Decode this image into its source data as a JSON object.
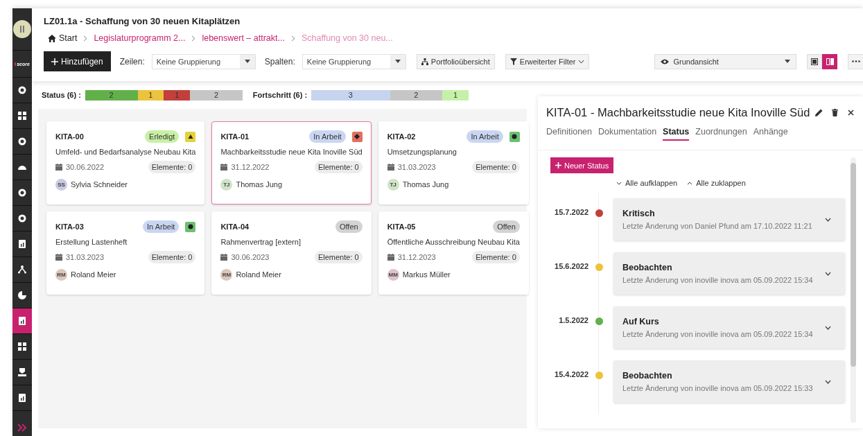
{
  "sidebar": {
    "logo": "score",
    "items": [
      {
        "selected": false
      },
      {
        "selected": false
      },
      {
        "selected": false
      },
      {
        "selected": false
      },
      {
        "selected": false
      },
      {
        "selected": false
      },
      {
        "selected": false
      },
      {
        "selected": false
      },
      {
        "selected": false
      },
      {
        "selected": true
      },
      {
        "selected": false
      },
      {
        "selected": false
      },
      {
        "selected": false
      }
    ]
  },
  "header": {
    "title": "LZ01.1a - Schaffung von 30 neuen Kitaplätzen",
    "breadcrumb": [
      {
        "label": "Start",
        "kind": "home"
      },
      {
        "label": "Legislaturprogramm 2...",
        "kind": "link"
      },
      {
        "label": "lebenswert – attrakt...",
        "kind": "link"
      },
      {
        "label": "Schaffung von 30 neu...",
        "kind": "current"
      }
    ]
  },
  "toolbar": {
    "add_button": "Hinzufügen",
    "rows_label": "Zeilen:",
    "rows_value": "Keine Gruppierung",
    "columns_label": "Spalten:",
    "columns_value": "Keine Gruppierung",
    "portfolio_button": "Portfolioübersicht",
    "filter_button": "Erweiterter Filter",
    "view_select": "Grundansicht",
    "view_toggle": [
      {
        "selected": false
      },
      {
        "selected": true
      }
    ]
  },
  "status_summary": {
    "label": "Status (6) :",
    "segments": [
      {
        "count": "2",
        "color": "#62b04a"
      },
      {
        "count": "1",
        "color": "#ecc33c"
      },
      {
        "count": "1",
        "color": "#c23f3c"
      },
      {
        "count": "2",
        "color": "#c6c6c6"
      }
    ]
  },
  "progress_summary": {
    "label": "Fortschritt (6) :",
    "segments": [
      {
        "count": "3",
        "color": "#c6d4f0"
      },
      {
        "count": "2",
        "color": "#c6c6c6"
      },
      {
        "count": "1",
        "color": "#c6f0a8"
      }
    ]
  },
  "cards": [
    {
      "id": "KITA-00",
      "title": "Umfeld- und Bedarfsanalyse Neubau Kita",
      "status": {
        "label": "Erledigt",
        "kind": "done"
      },
      "indicator": {
        "kind": "triangle",
        "color": "#e4d23a"
      },
      "date": "30.06.2022",
      "elements": "Elemente: 0",
      "avatar": {
        "initials": "SS",
        "color": "#c9c9e2"
      },
      "person": "Sylvia Schneider",
      "selected": false
    },
    {
      "id": "KITA-01",
      "title": "Machbarkeitsstudie neue Kita Inoville Süd",
      "status": {
        "label": "In Arbeit",
        "kind": "progress"
      },
      "indicator": {
        "kind": "diamond",
        "color": "#e0705e"
      },
      "date": "31.12.2022",
      "elements": "Elemente: 0",
      "avatar": {
        "initials": "TJ",
        "color": "#cfe3c6"
      },
      "person": "Thomas Jung",
      "selected": true
    },
    {
      "id": "KITA-02",
      "title": "Umsetzungsplanung",
      "status": {
        "label": "In Arbeit",
        "kind": "progress"
      },
      "indicator": {
        "kind": "dot",
        "color": "#6cc070"
      },
      "date": "31.03.2023",
      "elements": "Elemente: 0",
      "avatar": {
        "initials": "TJ",
        "color": "#cfe3c6"
      },
      "person": "Thomas Jung",
      "selected": false
    },
    {
      "id": "KITA-03",
      "title": "Erstellung Lastenheft",
      "status": {
        "label": "In Arbeit",
        "kind": "progress"
      },
      "indicator": {
        "kind": "dot",
        "color": "#6cc070"
      },
      "date": "31.03.2023",
      "elements": "Elemente: 0",
      "avatar": {
        "initials": "RM",
        "color": "#dcc7bd"
      },
      "person": "Roland Meier",
      "selected": false
    },
    {
      "id": "KITA-04",
      "title": "Rahmenvertrag [extern]",
      "status": {
        "label": "Offen",
        "kind": "open"
      },
      "date": "30.06.2023",
      "elements": "Elemente: 0",
      "avatar": {
        "initials": "RM",
        "color": "#dcc7bd"
      },
      "person": "Roland Meier",
      "selected": false
    },
    {
      "id": "KITA-05",
      "title": "Öffentliche Ausschreibung Neubau Kita",
      "status": {
        "label": "Offen",
        "kind": "open"
      },
      "date": "31.12.2023",
      "elements": "Elemente: 0",
      "avatar": {
        "initials": "MM",
        "color": "#dec2cc"
      },
      "person": "Markus Müller",
      "selected": false
    }
  ],
  "detail": {
    "title": "KITA-01 - Machbarkeitsstudie neue Kita Inoville Süd",
    "tabs": [
      {
        "label": "Definitionen",
        "selected": false
      },
      {
        "label": "Dokumentation",
        "selected": false
      },
      {
        "label": "Status",
        "selected": true
      },
      {
        "label": "Zuordnungen",
        "selected": false
      },
      {
        "label": "Anhänge",
        "selected": false
      }
    ],
    "new_button": "Neuer Status",
    "expand_all": "Alle aufklappen",
    "collapse_all": "Alle zuklappen",
    "timeline": [
      {
        "date": "15.7.2022",
        "color": "#c23f3c",
        "title": "Kritisch",
        "changed": "Letzte Änderung von Daniel Pfund am 17.10.2022 11:21"
      },
      {
        "date": "15.6.2022",
        "color": "#ecc33c",
        "title": "Beobachten",
        "changed": "Letzte Änderung von inoville inova am 05.09.2022 15:34"
      },
      {
        "date": "1.5.2022",
        "color": "#62b04a",
        "title": "Auf Kurs",
        "changed": "Letzte Änderung von inoville inova am 05.09.2022 15:34"
      },
      {
        "date": "15.4.2022",
        "color": "#ecc33c",
        "title": "Beobachten",
        "changed": "Letzte Änderung von inoville inova am 05.09.2022 15:33"
      }
    ]
  }
}
